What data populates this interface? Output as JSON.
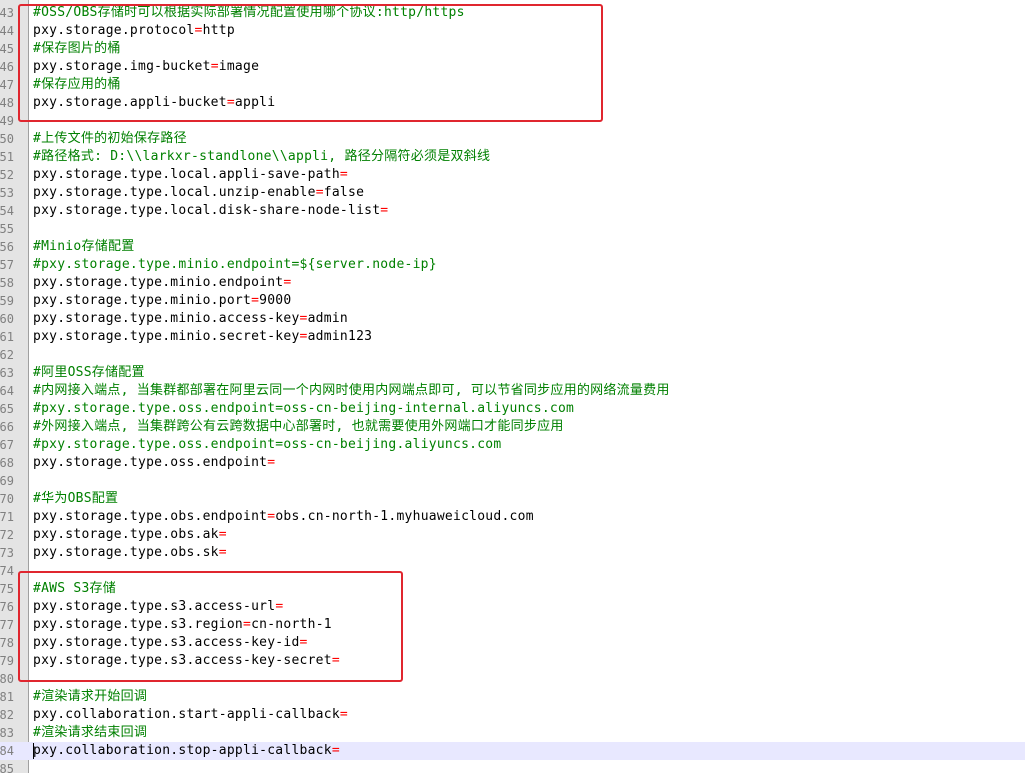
{
  "editor": {
    "current_line_index": 41,
    "colors": {
      "comment": "#008000",
      "operator": "#ff0000",
      "text": "#000000",
      "current_line": "#e8e8ff",
      "annotation_box": "#e0262f"
    },
    "lines": [
      {
        "n": "43",
        "type": "comment",
        "text": "#OSS/OBS存储时可以根据实际部署情况配置使用哪个协议:http/https"
      },
      {
        "n": "44",
        "type": "kv",
        "key": "pxy.storage.protocol",
        "value": "http"
      },
      {
        "n": "45",
        "type": "comment",
        "text": "#保存图片的桶"
      },
      {
        "n": "46",
        "type": "kv",
        "key": "pxy.storage.img-bucket",
        "value": "image"
      },
      {
        "n": "47",
        "type": "comment",
        "text": "#保存应用的桶"
      },
      {
        "n": "48",
        "type": "kv",
        "key": "pxy.storage.appli-bucket",
        "value": "appli"
      },
      {
        "n": "49",
        "type": "blank"
      },
      {
        "n": "50",
        "type": "comment",
        "text": "#上传文件的初始保存路径"
      },
      {
        "n": "51",
        "type": "comment",
        "text": "#路径格式: D:\\\\larkxr-standlone\\\\appli, 路径分隔符必须是双斜线"
      },
      {
        "n": "52",
        "type": "kv",
        "key": "pxy.storage.type.local.appli-save-path",
        "value": ""
      },
      {
        "n": "53",
        "type": "kv",
        "key": "pxy.storage.type.local.unzip-enable",
        "value": "false"
      },
      {
        "n": "54",
        "type": "kv",
        "key": "pxy.storage.type.local.disk-share-node-list",
        "value": ""
      },
      {
        "n": "55",
        "type": "blank"
      },
      {
        "n": "56",
        "type": "comment",
        "text": "#Minio存储配置"
      },
      {
        "n": "57",
        "type": "comment",
        "text": "#pxy.storage.type.minio.endpoint=${server.node-ip}"
      },
      {
        "n": "58",
        "type": "kv",
        "key": "pxy.storage.type.minio.endpoint",
        "value": ""
      },
      {
        "n": "59",
        "type": "kv",
        "key": "pxy.storage.type.minio.port",
        "value": "9000"
      },
      {
        "n": "60",
        "type": "kv",
        "key": "pxy.storage.type.minio.access-key",
        "value": "admin"
      },
      {
        "n": "61",
        "type": "kv",
        "key": "pxy.storage.type.minio.secret-key",
        "value": "admin123"
      },
      {
        "n": "62",
        "type": "blank"
      },
      {
        "n": "63",
        "type": "comment",
        "text": "#阿里OSS存储配置"
      },
      {
        "n": "64",
        "type": "comment",
        "text": "#内网接入端点, 当集群都部署在阿里云同一个内网时使用内网端点即可, 可以节省同步应用的网络流量费用"
      },
      {
        "n": "65",
        "type": "comment",
        "text": "#pxy.storage.type.oss.endpoint=oss-cn-beijing-internal.aliyuncs.com"
      },
      {
        "n": "66",
        "type": "comment",
        "text": "#外网接入端点, 当集群跨公有云跨数据中心部署时, 也就需要使用外网端口才能同步应用"
      },
      {
        "n": "67",
        "type": "comment",
        "text": "#pxy.storage.type.oss.endpoint=oss-cn-beijing.aliyuncs.com"
      },
      {
        "n": "68",
        "type": "kv",
        "key": "pxy.storage.type.oss.endpoint",
        "value": ""
      },
      {
        "n": "69",
        "type": "blank"
      },
      {
        "n": "70",
        "type": "comment",
        "text": "#华为OBS配置"
      },
      {
        "n": "71",
        "type": "kv",
        "key": "pxy.storage.type.obs.endpoint",
        "value": "obs.cn-north-1.myhuaweicloud.com"
      },
      {
        "n": "72",
        "type": "kv",
        "key": "pxy.storage.type.obs.ak",
        "value": ""
      },
      {
        "n": "73",
        "type": "kv",
        "key": "pxy.storage.type.obs.sk",
        "value": ""
      },
      {
        "n": "74",
        "type": "blank"
      },
      {
        "n": "75",
        "type": "comment",
        "text": "#AWS S3存储"
      },
      {
        "n": "76",
        "type": "kv",
        "key": "pxy.storage.type.s3.access-url",
        "value": ""
      },
      {
        "n": "77",
        "type": "kv",
        "key": "pxy.storage.type.s3.region",
        "value": "cn-north-1"
      },
      {
        "n": "78",
        "type": "kv",
        "key": "pxy.storage.type.s3.access-key-id",
        "value": ""
      },
      {
        "n": "79",
        "type": "kv",
        "key": "pxy.storage.type.s3.access-key-secret",
        "value": ""
      },
      {
        "n": "80",
        "type": "blank"
      },
      {
        "n": "81",
        "type": "comment",
        "text": "#渲染请求开始回调"
      },
      {
        "n": "82",
        "type": "kv",
        "key": "pxy.collaboration.start-appli-callback",
        "value": ""
      },
      {
        "n": "83",
        "type": "comment",
        "text": "#渲染请求结束回调"
      },
      {
        "n": "84",
        "type": "kv",
        "key": "pxy.collaboration.stop-appli-callback",
        "value": ""
      },
      {
        "n": "85",
        "type": "blank"
      }
    ]
  }
}
